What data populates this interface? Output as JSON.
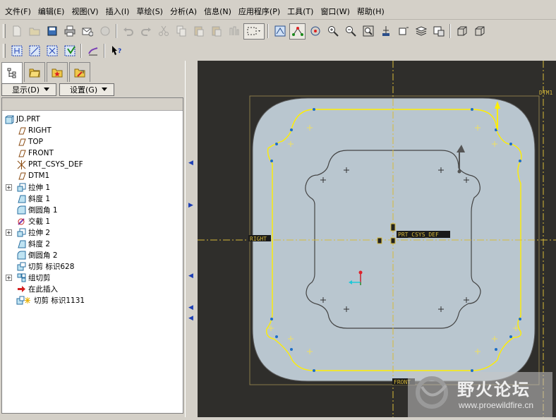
{
  "menu": [
    "文件(F)",
    "编辑(E)",
    "视图(V)",
    "插入(I)",
    "草绘(S)",
    "分析(A)",
    "信息(N)",
    "应用程序(P)",
    "工具(T)",
    "窗口(W)",
    "帮助(H)"
  ],
  "left_panel": {
    "show_button": "显示(D)",
    "settings_button": "设置(G)",
    "tree": [
      {
        "label": "JD.PRT",
        "icon": "part-icon",
        "expander": "",
        "level": 0
      },
      {
        "label": "RIGHT",
        "icon": "datum-plane-icon",
        "expander": "",
        "level": 1
      },
      {
        "label": "TOP",
        "icon": "datum-plane-icon",
        "expander": "",
        "level": 1
      },
      {
        "label": "FRONT",
        "icon": "datum-plane-icon",
        "expander": "",
        "level": 1
      },
      {
        "label": "PRT_CSYS_DEF",
        "icon": "csys-icon",
        "expander": "",
        "level": 1
      },
      {
        "label": "DTM1",
        "icon": "datum-plane-icon",
        "expander": "",
        "level": 1
      },
      {
        "label": "拉伸 1",
        "icon": "extrude-icon",
        "expander": "+",
        "level": 1
      },
      {
        "label": "斜度 1",
        "icon": "draft-icon",
        "expander": "",
        "level": 1
      },
      {
        "label": "倒圆角 1",
        "icon": "round-icon",
        "expander": "",
        "level": 1
      },
      {
        "label": "交截 1",
        "icon": "intersect-icon",
        "expander": "",
        "level": 1
      },
      {
        "label": "拉伸 2",
        "icon": "extrude-icon",
        "expander": "+",
        "level": 1
      },
      {
        "label": "斜度 2",
        "icon": "draft-icon",
        "expander": "",
        "level": 1
      },
      {
        "label": "倒圆角 2",
        "icon": "round-icon",
        "expander": "",
        "level": 1
      },
      {
        "label": "切剪 标识628",
        "icon": "cut-icon",
        "expander": "",
        "level": 1
      },
      {
        "label": "组切剪",
        "icon": "group-icon",
        "expander": "+",
        "level": 1
      },
      {
        "label": "在此插入",
        "icon": "insert-here-icon",
        "expander": "",
        "level": 1
      },
      {
        "label": "切剪 标识1131",
        "icon": "cut-new-icon",
        "expander": "",
        "level": 1
      }
    ]
  },
  "viewport": {
    "datum_labels": {
      "right": "RIGHT",
      "csys": "PRT_CSYS_DEF",
      "front": "FRONT",
      "dtm": "DTM1"
    }
  },
  "watermark": {
    "text": "野火论坛",
    "url": "www.proewildfire.cn"
  },
  "colors": {
    "viewport_bg": "#2f2e2b",
    "part_fill": "#b9c6cf",
    "sketch_yellow": "#ffee00",
    "datum_yellow": "#d7b93a",
    "select_blue": "#1d3fb5"
  }
}
